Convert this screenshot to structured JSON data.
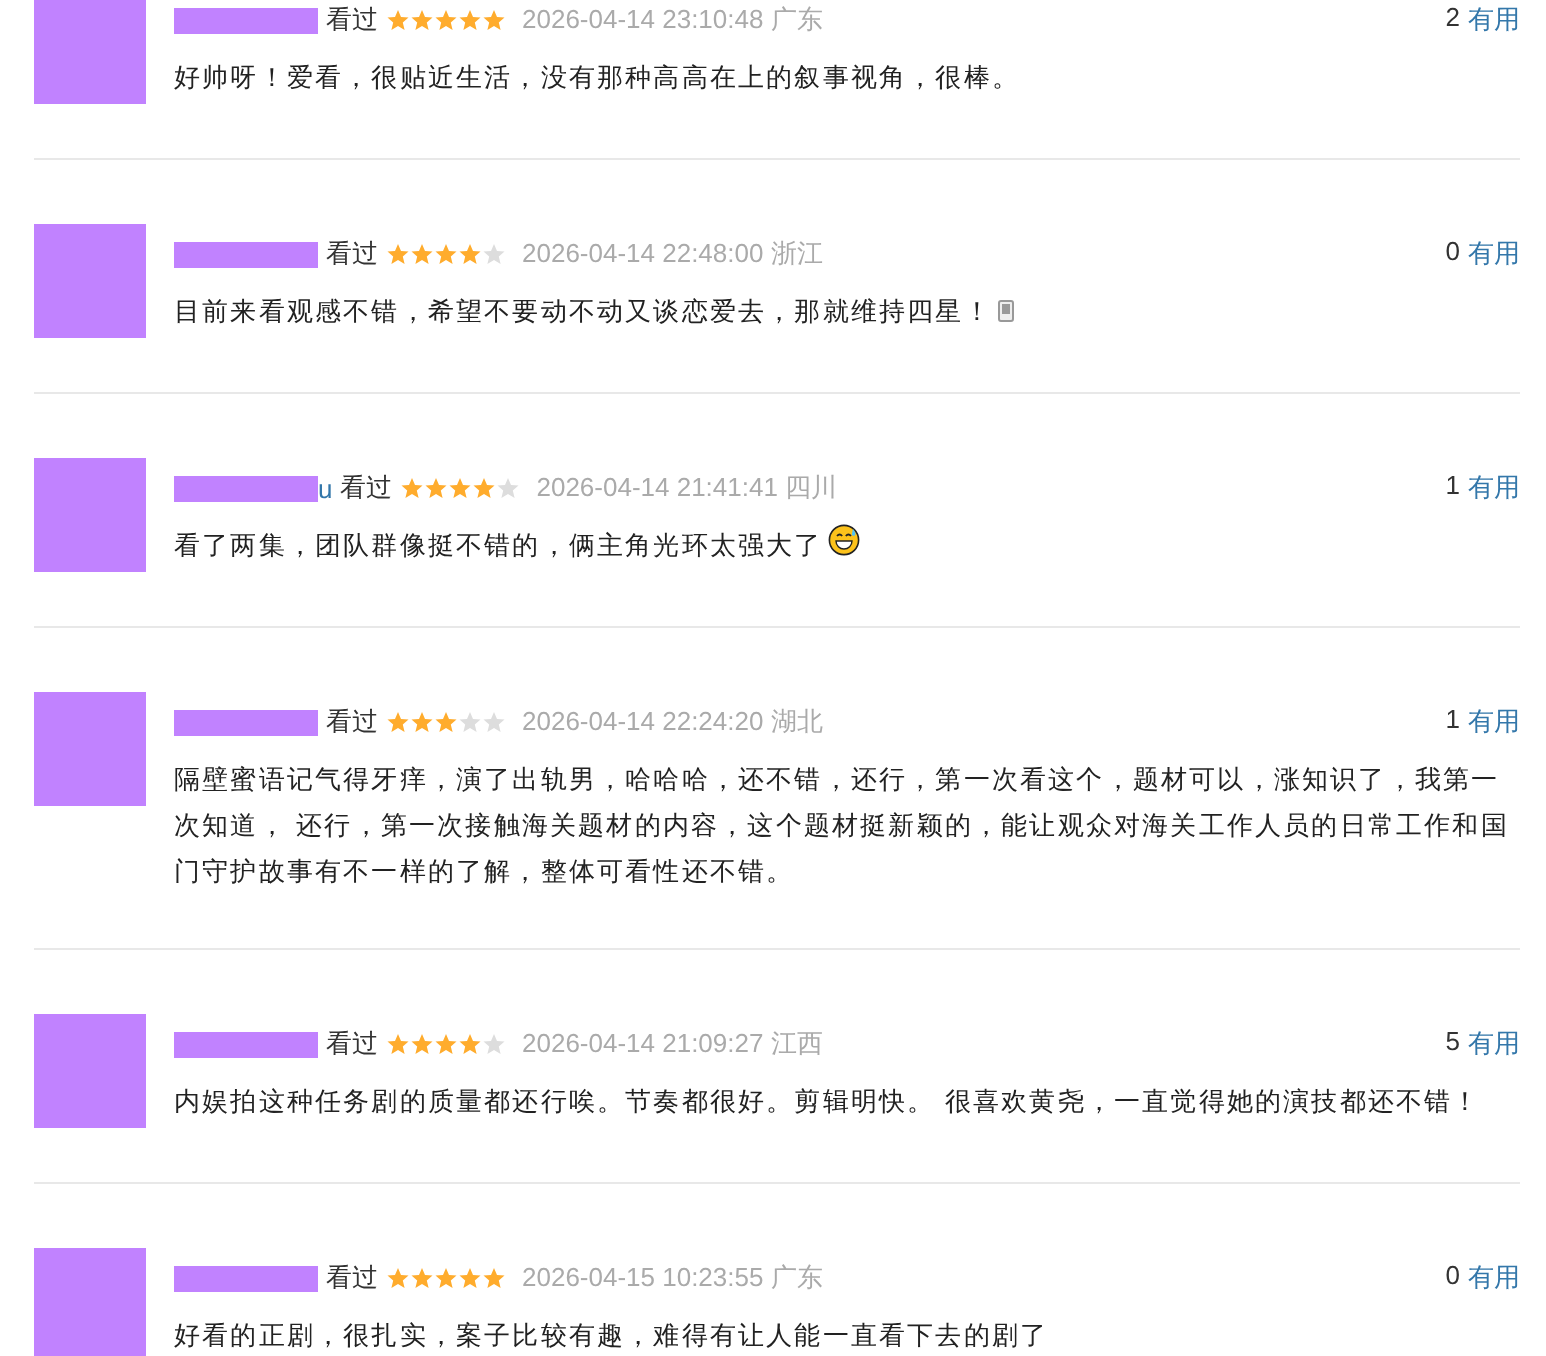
{
  "reviews": [
    {
      "status": "看过",
      "stars": 5,
      "time": "2026-04-14 23:10:48",
      "location": "广东",
      "useful_count": "2",
      "useful_label": "有用",
      "text": "好帅呀！爱看，很贴近生活，没有那种高高在上的叙事视角，很棒。",
      "mobile": false,
      "emoji": false
    },
    {
      "status": "看过",
      "stars": 4,
      "time": "2026-04-14 22:48:00",
      "location": "浙江",
      "useful_count": "0",
      "useful_label": "有用",
      "text": "目前来看观感不错，希望不要动不动又谈恋爱去，那就维持四星！",
      "mobile": true,
      "emoji": false
    },
    {
      "name_tail": "u",
      "status": "看过",
      "stars": 4,
      "time": "2026-04-14 21:41:41",
      "location": "四川",
      "useful_count": "1",
      "useful_label": "有用",
      "text": "看了两集，团队群像挺不错的，俩主角光环太强大了",
      "mobile": false,
      "emoji": true
    },
    {
      "status": "看过",
      "stars": 3,
      "time": "2026-04-14 22:24:20",
      "location": "湖北",
      "useful_count": "1",
      "useful_label": "有用",
      "text": "隔壁蜜语记气得牙痒，演了出轨男，哈哈哈，还不错，还行，第一次看这个，题材可以，涨知识了，我第一次知道， 还行，第一次接触海关题材的内容，这个题材挺新颖的，能让观众对海关工作人员的日常工作和国门守护故事有不一样的了解，整体可看性还不错。",
      "mobile": false,
      "emoji": false
    },
    {
      "status": "看过",
      "stars": 4,
      "time": "2026-04-14 21:09:27",
      "location": "江西",
      "useful_count": "5",
      "useful_label": "有用",
      "text": "内娱拍这种任务剧的质量都还行唉。节奏都很好。剪辑明快。 很喜欢黄尧，一直觉得她的演技都还不错！",
      "mobile": false,
      "emoji": false
    },
    {
      "status": "看过",
      "stars": 5,
      "time": "2026-04-15 10:23:55",
      "location": "广东",
      "useful_count": "0",
      "useful_label": "有用",
      "text": "好看的正剧，很扎实，案子比较有趣，难得有让人能一直看下去的剧了",
      "mobile": false,
      "emoji": false
    }
  ]
}
